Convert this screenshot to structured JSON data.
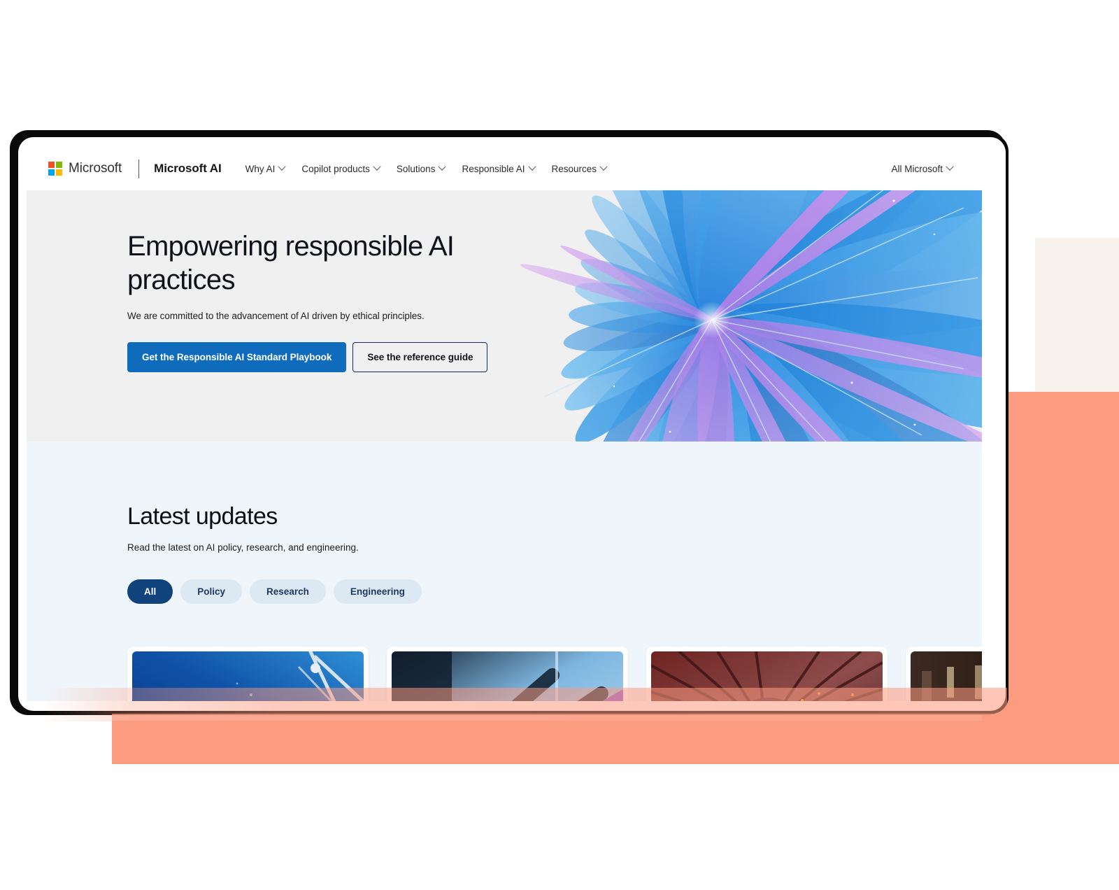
{
  "brand": {
    "company": "Microsoft",
    "product": "Microsoft AI",
    "logo_colors": {
      "red": "#f25022",
      "green": "#7fba00",
      "blue": "#00a4ef",
      "yellow": "#ffb900"
    }
  },
  "nav": {
    "items": [
      {
        "label": "Why AI",
        "has_chevron": true
      },
      {
        "label": "Copilot products",
        "has_chevron": true
      },
      {
        "label": "Solutions",
        "has_chevron": true
      },
      {
        "label": "Responsible AI",
        "has_chevron": true
      },
      {
        "label": "Resources",
        "has_chevron": true
      }
    ],
    "right": {
      "label": "All Microsoft",
      "has_chevron": true
    }
  },
  "hero": {
    "title": "Empowering responsible AI practices",
    "subtitle": "We are committed to the advancement of AI driven by ethical principles.",
    "primary_button": "Get the Responsible AI Standard Playbook",
    "secondary_button": "See the reference guide",
    "background_color": "#f0f0f0",
    "primary_button_color": "#0f6cbd",
    "artwork": "abstract-blue-purple-radial-fan"
  },
  "updates": {
    "title": "Latest updates",
    "subtitle": "Read the latest on AI policy, research, and engineering.",
    "background_color": "#eff6fb",
    "filters": [
      {
        "label": "All",
        "active": true
      },
      {
        "label": "Policy",
        "active": false
      },
      {
        "label": "Research",
        "active": false
      },
      {
        "label": "Engineering",
        "active": false
      }
    ],
    "active_filter_color": "#10427c",
    "cards": [
      {
        "image": "blue-sky-satellite-antenna-structure"
      },
      {
        "image": "dark-blue-industrial-metal-beams"
      },
      {
        "image": "red-domed-atrium-ceiling-with-lights"
      },
      {
        "image": "person-in-orange-at-indoor-cafe"
      }
    ]
  },
  "decor": {
    "cream_rect_color": "#f8f2ec",
    "coral_rect_color": "#fb9b80",
    "device_frame_color": "#0a0a0a"
  }
}
